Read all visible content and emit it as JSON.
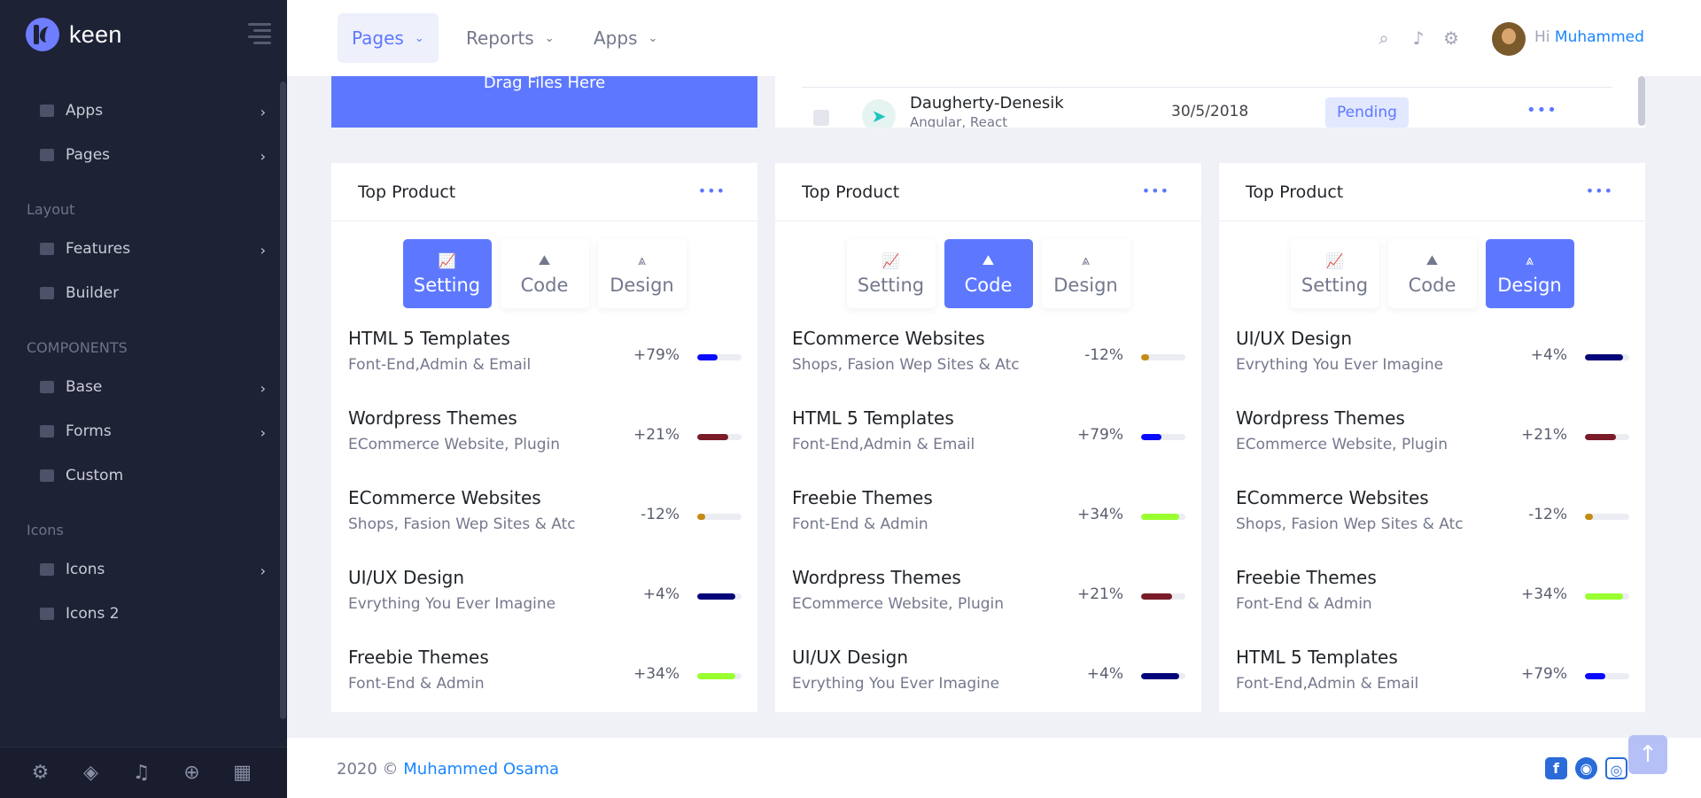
{
  "brand": {
    "name": "keen"
  },
  "sidebar": {
    "items": [
      {
        "label": "Apps",
        "icon": "send-icon",
        "has_children": true
      },
      {
        "label": "Pages",
        "icon": "document-icon",
        "has_children": true
      }
    ],
    "sections": [
      {
        "title": "Layout",
        "items": [
          {
            "label": "Features",
            "icon": "layers-icon",
            "has_children": true
          },
          {
            "label": "Builder",
            "icon": "chart-icon",
            "has_children": false
          }
        ]
      },
      {
        "title": "COMPONENTS",
        "items": [
          {
            "label": "Base",
            "icon": "box-icon",
            "has_children": true
          },
          {
            "label": "Forms",
            "icon": "database-icon",
            "has_children": true
          },
          {
            "label": "Custom",
            "icon": "calendar-icon",
            "has_children": false
          }
        ]
      },
      {
        "title": "Icons",
        "items": [
          {
            "label": "Icons",
            "icon": "grid-icon",
            "has_children": true
          },
          {
            "label": "Icons 2",
            "icon": "grid-icon",
            "has_children": false
          }
        ]
      }
    ],
    "footer_icons": [
      "settings-icon",
      "box-icon",
      "bell-icon",
      "plus-circle-icon",
      "calendar-add-icon"
    ]
  },
  "header": {
    "menus": [
      {
        "label": "Pages",
        "active": true
      },
      {
        "label": "Reports",
        "active": false
      },
      {
        "label": "Apps",
        "active": false
      }
    ],
    "greeting": "Hi",
    "user_name": "Muhammed"
  },
  "dropzone": {
    "label": "Drag Files Here"
  },
  "table_row": {
    "company": "Daugherty-Denesik",
    "tech": "Angular, React",
    "date": "30/5/2018",
    "status": "Pending"
  },
  "cards": [
    {
      "title": "Top Product",
      "tabs": [
        {
          "label": "Setting",
          "icon": "chart-line-icon",
          "active": true
        },
        {
          "label": "Code",
          "icon": "map-icon",
          "active": false
        },
        {
          "label": "Design",
          "icon": "design-icon",
          "active": false
        }
      ],
      "products": [
        {
          "name": "HTML 5 Templates",
          "sub": "Font-End,Admin & Email",
          "pct": "+79%",
          "progress": 0.45,
          "color": "#0a0aff"
        },
        {
          "name": "Wordpress Themes",
          "sub": "ECommerce Website, Plugin",
          "pct": "+21%",
          "progress": 0.7,
          "color": "#7a1c28"
        },
        {
          "name": "ECommerce Websites",
          "sub": "Shops, Fasion Wep Sites & Atc",
          "pct": "-12%",
          "progress": 0.18,
          "color": "#c48a12"
        },
        {
          "name": "UI/UX Design",
          "sub": "Evrything You Ever Imagine",
          "pct": "+4%",
          "progress": 0.85,
          "color": "#05057a"
        },
        {
          "name": "Freebie Themes",
          "sub": "Font-End & Admin",
          "pct": "+34%",
          "progress": 0.85,
          "color": "#9aff2e"
        }
      ]
    },
    {
      "title": "Top Product",
      "tabs": [
        {
          "label": "Setting",
          "icon": "chart-line-icon",
          "active": false
        },
        {
          "label": "Code",
          "icon": "map-icon",
          "active": true
        },
        {
          "label": "Design",
          "icon": "design-icon",
          "active": false
        }
      ],
      "products": [
        {
          "name": "ECommerce Websites",
          "sub": "Shops, Fasion Wep Sites & Atc",
          "pct": "-12%",
          "progress": 0.18,
          "color": "#c48a12"
        },
        {
          "name": "HTML 5 Templates",
          "sub": "Font-End,Admin & Email",
          "pct": "+79%",
          "progress": 0.45,
          "color": "#0a0aff"
        },
        {
          "name": "Freebie Themes",
          "sub": "Font-End & Admin",
          "pct": "+34%",
          "progress": 0.85,
          "color": "#9aff2e"
        },
        {
          "name": "Wordpress Themes",
          "sub": "ECommerce Website, Plugin",
          "pct": "+21%",
          "progress": 0.7,
          "color": "#7a1c28"
        },
        {
          "name": "UI/UX Design",
          "sub": "Evrything You Ever Imagine",
          "pct": "+4%",
          "progress": 0.85,
          "color": "#05057a"
        }
      ]
    },
    {
      "title": "Top Product",
      "tabs": [
        {
          "label": "Setting",
          "icon": "chart-line-icon",
          "active": false
        },
        {
          "label": "Code",
          "icon": "map-icon",
          "active": false
        },
        {
          "label": "Design",
          "icon": "design-icon",
          "active": true
        }
      ],
      "products": [
        {
          "name": "UI/UX Design",
          "sub": "Evrything You Ever Imagine",
          "pct": "+4%",
          "progress": 0.85,
          "color": "#05057a"
        },
        {
          "name": "Wordpress Themes",
          "sub": "ECommerce Website, Plugin",
          "pct": "+21%",
          "progress": 0.7,
          "color": "#7a1c28"
        },
        {
          "name": "ECommerce Websites",
          "sub": "Shops, Fasion Wep Sites & Atc",
          "pct": "-12%",
          "progress": 0.18,
          "color": "#c48a12"
        },
        {
          "name": "Freebie Themes",
          "sub": "Font-End & Admin",
          "pct": "+34%",
          "progress": 0.85,
          "color": "#9aff2e"
        },
        {
          "name": "HTML 5 Templates",
          "sub": "Font-End,Admin & Email",
          "pct": "+79%",
          "progress": 0.45,
          "color": "#0a0aff"
        }
      ]
    }
  ],
  "footer": {
    "copyright": "2020 ©",
    "author": "Muhammed Osama",
    "social": [
      "facebook-icon",
      "github-icon",
      "instagram-icon"
    ]
  },
  "colors": {
    "primary": "#5d78ff",
    "sidebar": "#1e2235",
    "link": "#1a85ff"
  }
}
